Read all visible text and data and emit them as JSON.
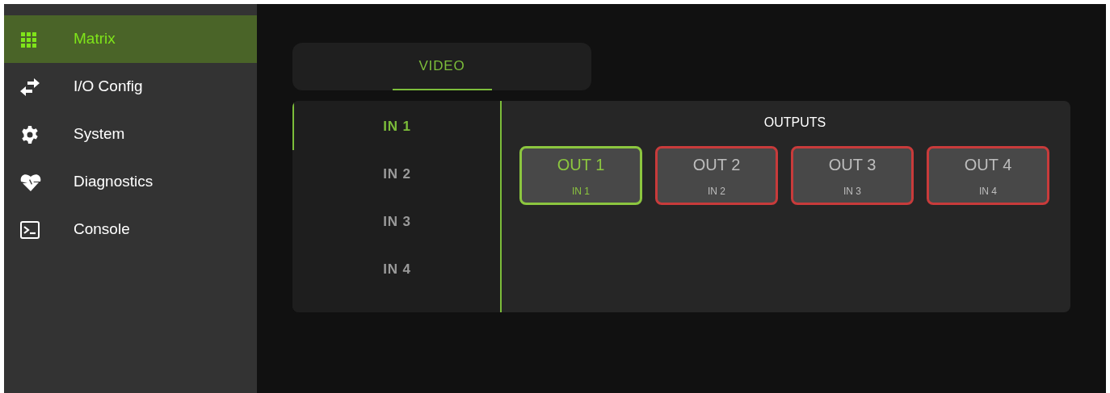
{
  "sidebar": {
    "items": [
      {
        "kind": "grid",
        "label": "Matrix",
        "selected": true
      },
      {
        "kind": "swap",
        "label": "I/O Config",
        "selected": false
      },
      {
        "kind": "gear",
        "label": "System",
        "selected": false
      },
      {
        "kind": "heart",
        "label": "Diagnostics",
        "selected": false
      },
      {
        "kind": "terminal",
        "label": "Console",
        "selected": false
      }
    ]
  },
  "tabs": [
    {
      "label": "VIDEO",
      "selected": true
    }
  ],
  "inputs": [
    {
      "label": "IN 1",
      "selected": true
    },
    {
      "label": "IN 2",
      "selected": false
    },
    {
      "label": "IN 3",
      "selected": false
    },
    {
      "label": "IN 4",
      "selected": false
    }
  ],
  "outputs": {
    "title": "OUTPUTS",
    "items": [
      {
        "label": "OUT 1",
        "source": "IN 1",
        "selected": true
      },
      {
        "label": "OUT 2",
        "source": "IN 2",
        "selected": false
      },
      {
        "label": "OUT 3",
        "source": "IN 3",
        "selected": false
      },
      {
        "label": "OUT 4",
        "source": "IN 4",
        "selected": false
      }
    ]
  }
}
